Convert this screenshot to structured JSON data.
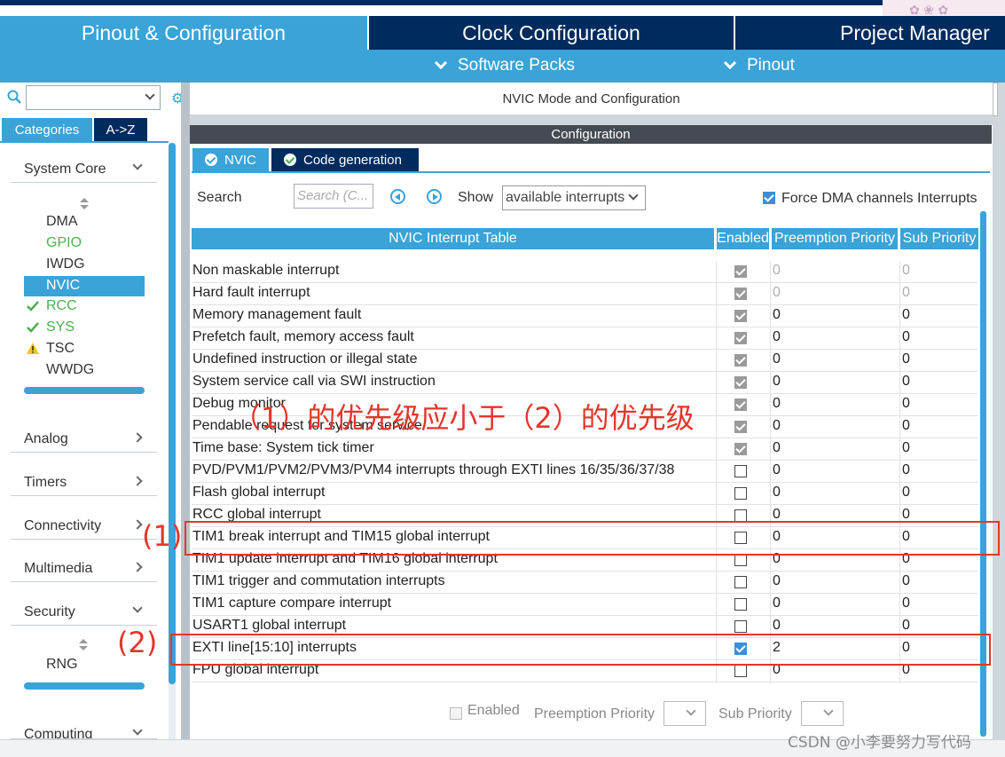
{
  "tabs": {
    "pinout": "Pinout & Configuration",
    "clock": "Clock Configuration",
    "project": "Project Manager"
  },
  "toolbar": {
    "software_packs": "Software Packs",
    "pinout": "Pinout"
  },
  "sidebar": {
    "category_tab": "Categories",
    "az_tab": "A->Z",
    "system_core": {
      "label": "System Core",
      "items": [
        {
          "label": "DMA",
          "status": "none"
        },
        {
          "label": "GPIO",
          "status": "green"
        },
        {
          "label": "IWDG",
          "status": "none"
        },
        {
          "label": "NVIC",
          "status": "selected"
        },
        {
          "label": "RCC",
          "status": "check"
        },
        {
          "label": "SYS",
          "status": "check"
        },
        {
          "label": "TSC",
          "status": "warning"
        },
        {
          "label": "WWDG",
          "status": "none"
        }
      ]
    },
    "categories": [
      "Analog",
      "Timers",
      "Connectivity",
      "Multimedia",
      "Security"
    ],
    "security_items": [
      "RNG"
    ],
    "computing": "Computing"
  },
  "main": {
    "mode_title": "NVIC Mode and Configuration",
    "config_title": "Configuration",
    "subtabs": [
      "NVIC",
      "Code generation"
    ],
    "search_label": "Search",
    "search_placeholder": "Search (C...",
    "show_label": "Show",
    "show_value": "available interrupts",
    "force_dma_label": "Force DMA channels Interrupts",
    "table": {
      "headers": [
        "NVIC Interrupt Table",
        "Enabled",
        "Preemption Priority",
        "Sub Priority"
      ],
      "rows": [
        {
          "name": "Non maskable interrupt",
          "enabled": "forced",
          "pre": "0",
          "sub": "0",
          "grey": true
        },
        {
          "name": "Hard fault interrupt",
          "enabled": "forced",
          "pre": "0",
          "sub": "0",
          "grey": true
        },
        {
          "name": "Memory management fault",
          "enabled": "forced",
          "pre": "0",
          "sub": "0"
        },
        {
          "name": "Prefetch fault, memory access fault",
          "enabled": "forced",
          "pre": "0",
          "sub": "0"
        },
        {
          "name": "Undefined instruction or illegal state",
          "enabled": "forced",
          "pre": "0",
          "sub": "0"
        },
        {
          "name": "System service call via SWI instruction",
          "enabled": "forced",
          "pre": "0",
          "sub": "0"
        },
        {
          "name": "Debug monitor",
          "enabled": "forced",
          "pre": "0",
          "sub": "0"
        },
        {
          "name": "Pendable request for system service",
          "enabled": "forced",
          "pre": "0",
          "sub": "0"
        },
        {
          "name": "Time base: System tick timer",
          "enabled": "forced",
          "pre": "0",
          "sub": "0"
        },
        {
          "name": "PVD/PVM1/PVM2/PVM3/PVM4 interrupts through EXTI lines 16/35/36/37/38",
          "enabled": "off",
          "pre": "0",
          "sub": "0"
        },
        {
          "name": "Flash global interrupt",
          "enabled": "off",
          "pre": "0",
          "sub": "0"
        },
        {
          "name": "RCC global interrupt",
          "enabled": "off",
          "pre": "0",
          "sub": "0"
        },
        {
          "name": "TIM1 break interrupt and TIM15 global interrupt",
          "enabled": "off",
          "pre": "0",
          "sub": "0"
        },
        {
          "name": "TIM1 update interrupt and TIM16 global interrupt",
          "enabled": "off",
          "pre": "0",
          "sub": "0"
        },
        {
          "name": "TIM1 trigger and commutation interrupts",
          "enabled": "off",
          "pre": "0",
          "sub": "0"
        },
        {
          "name": "TIM1 capture compare interrupt",
          "enabled": "off",
          "pre": "0",
          "sub": "0"
        },
        {
          "name": "USART1 global interrupt",
          "enabled": "off",
          "pre": "0",
          "sub": "0"
        },
        {
          "name": "EXTI line[15:10] interrupts",
          "enabled": "on",
          "pre": "2",
          "sub": "0"
        },
        {
          "name": "FPU global interrupt",
          "enabled": "off",
          "pre": "0",
          "sub": "0"
        }
      ]
    },
    "bottom": {
      "enabled": "Enabled",
      "preemption": "Preemption Priority",
      "sub": "Sub Priority"
    }
  },
  "annotations": {
    "note": "（1）的优先级应小于（2）的优先级",
    "label1": "(1)",
    "label2": "(2)"
  },
  "watermark": "CSDN @小李要努力写代码",
  "colors": {
    "accent": "#3aa3d8",
    "navy": "#002b5e",
    "annotation": "#e5352b"
  }
}
